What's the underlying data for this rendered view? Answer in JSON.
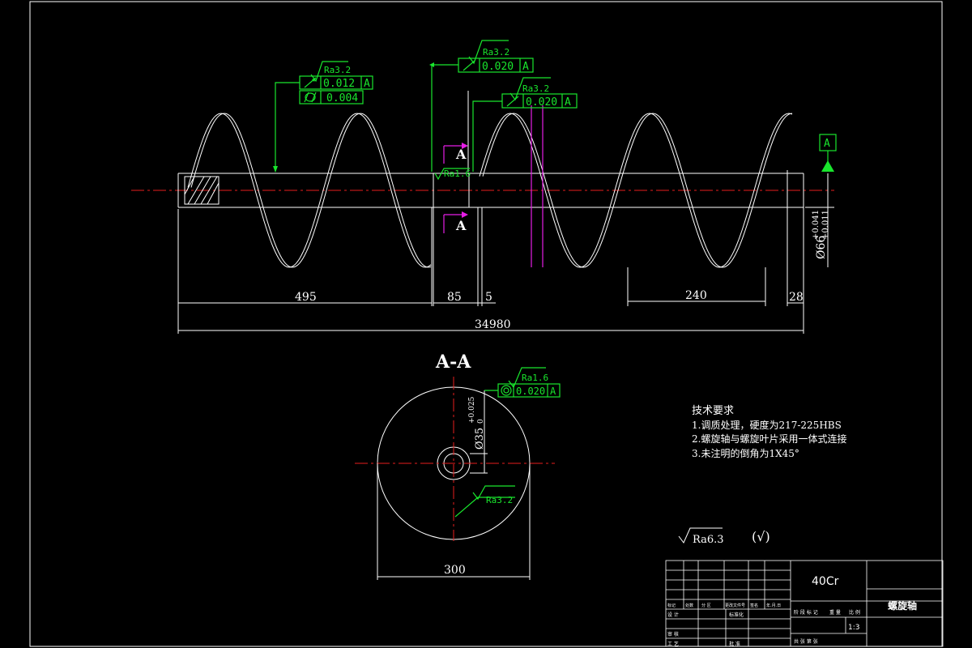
{
  "dimensions": {
    "d495": "495",
    "d85": "85",
    "d5": "5",
    "d240": "240",
    "d28": "28",
    "d34980": "34980",
    "d300": "300",
    "shaft_dia": "Ø66",
    "shaft_tol_upper": "+0.041",
    "shaft_tol_lower": "+0.011",
    "bore_dia": "Ø35",
    "bore_tol_upper": "+0.025",
    "bore_tol_lower": "0"
  },
  "section": {
    "marker": "A",
    "title": "A-A"
  },
  "datum": {
    "label": "A"
  },
  "roughness": {
    "r1": "Ra3.2",
    "r2": "Ra3.2",
    "r3": "Ra3.2",
    "r4": "Ra1.6",
    "r5": "Ra1.6",
    "r6": "Ra3.2",
    "general": "Ra6.3",
    "general_paren": "(√)"
  },
  "tolerances": {
    "t1": {
      "value": "0.012",
      "datum": "A"
    },
    "t2": {
      "value": "0.004"
    },
    "t3": {
      "value": "0.020",
      "datum": "A"
    },
    "t4": {
      "value": "0.020",
      "datum": "A"
    },
    "t5": {
      "value": "0.020",
      "datum": "A"
    }
  },
  "notes": {
    "title": "技术要求",
    "items": [
      "1.调质处理，硬度为217-225HBS",
      "2.螺旋轴与螺旋叶片采用一体式连接",
      "3.未注明的倒角为1X45°"
    ]
  },
  "title_block": {
    "material": "40Cr",
    "part_name": "螺旋轴",
    "scale": "1:3",
    "header_labels": [
      "标记",
      "处数",
      "分 区",
      "更改文件号",
      "签名",
      "年.月.日"
    ],
    "row_labels": [
      "设 计",
      "标准化",
      "审 核",
      "工 艺",
      "批 准"
    ],
    "right_labels": [
      "阶 段 标 记",
      "重 量",
      "比 例"
    ],
    "sheet_info": "共 张  第 张"
  },
  "colors": {
    "background": "#000000",
    "geometry": "#ffffff",
    "annotation": "#19e62d",
    "centerline": "#e61e1e",
    "section_line": "#e61ee6"
  }
}
